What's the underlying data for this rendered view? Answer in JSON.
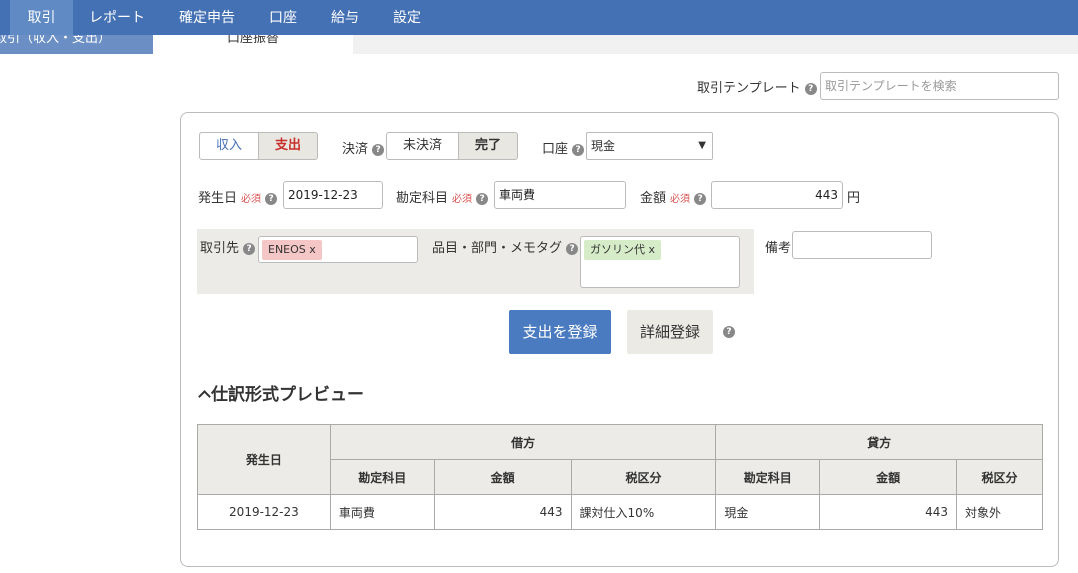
{
  "nav": {
    "items": [
      "取引",
      "レポート",
      "確定申告",
      "口座",
      "給与",
      "設定"
    ],
    "active_index": 0
  },
  "subtabs": {
    "first": "取引（収入・支出）",
    "second": "口座振替"
  },
  "template": {
    "label": "取引テンプレート",
    "placeholder": "取引テンプレートを検索"
  },
  "form": {
    "type_income": "収入",
    "type_expense": "支出",
    "settlement_label": "決済",
    "unsettled": "未決済",
    "settled": "完了",
    "account_label": "口座",
    "account_value": "現金",
    "date_label": "発生日",
    "required": "必須",
    "date_value": "2019-12-23",
    "item_label": "勘定科目",
    "item_value": "車両費",
    "amount_label": "金額",
    "amount_value": "443",
    "currency": "円",
    "partner_label": "取引先",
    "partner_tag": "ENEOS x",
    "tags_label": "品目・部門・メモタグ",
    "tag_value": "ガソリン代 x",
    "memo_label": "備考",
    "memo_value": "",
    "submit_label": "支出を登録",
    "detail_label": "詳細登録",
    "help_glyph": "?"
  },
  "preview": {
    "title": "仕訳形式プレビュー",
    "headers": {
      "date": "発生日",
      "debit": "借方",
      "credit": "貸方",
      "account": "勘定科目",
      "amount": "金額",
      "tax": "税区分"
    },
    "rows": [
      {
        "date": "2019-12-23",
        "debit_account": "車両費",
        "debit_amount": "443",
        "debit_tax": "課対仕入10%",
        "credit_account": "現金",
        "credit_amount": "443",
        "credit_tax": "対象外"
      }
    ]
  }
}
